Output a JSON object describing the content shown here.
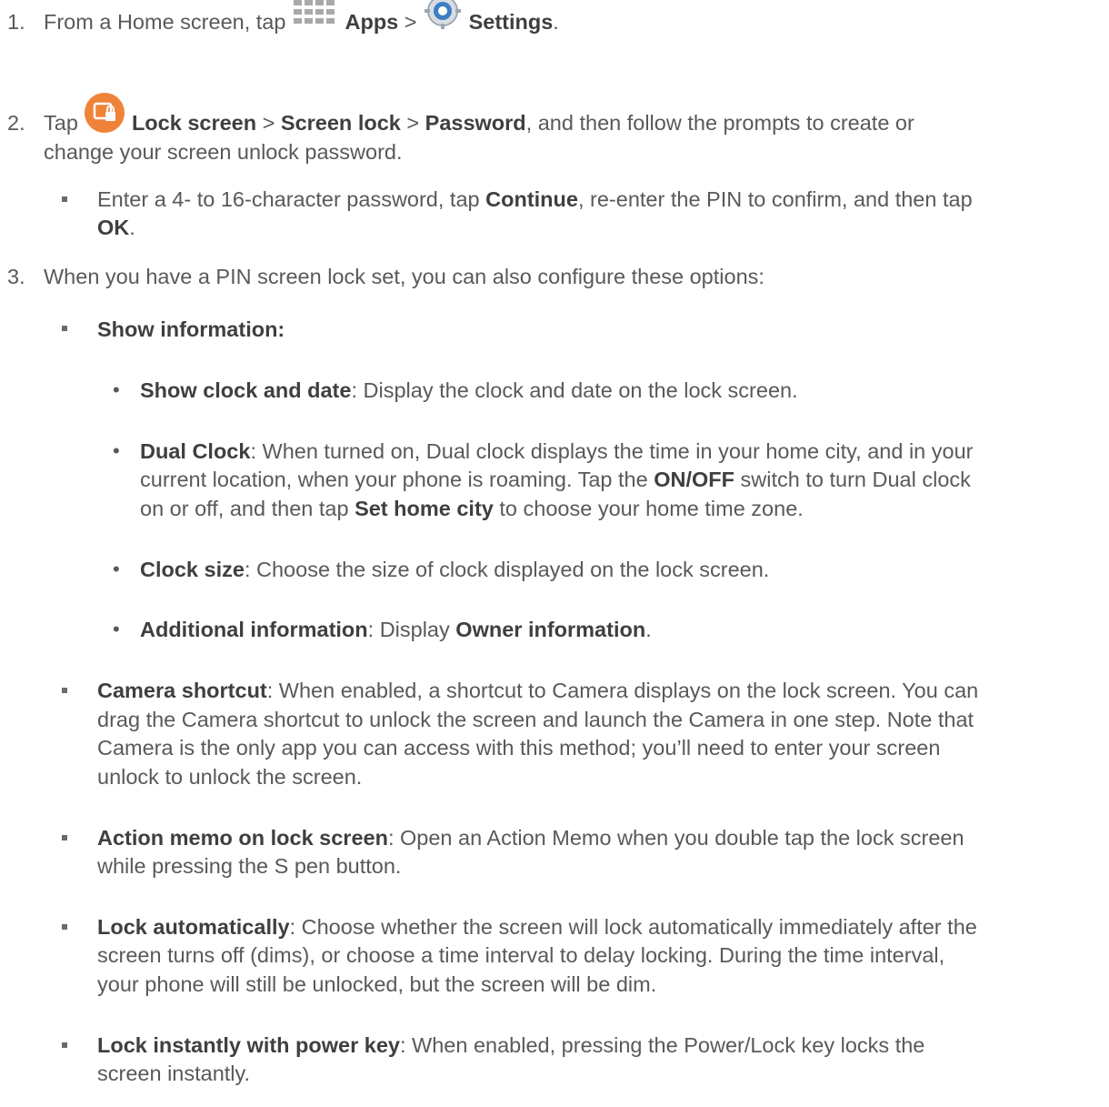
{
  "icons": {
    "apps": "apps-grid-icon",
    "settings": "settings-gear-icon",
    "lock": "lock-screen-icon"
  },
  "colors": {
    "text": "#595959",
    "bold": "#3f3f3f",
    "apps_icon": "#a9a9a9",
    "settings_icon": "#3b7fc4",
    "lock_icon": "#f0833a"
  },
  "steps": {
    "s1": {
      "num": "1.",
      "pre": "From a Home screen, tap",
      "apps": "Apps",
      "gt": ">",
      "settings": "Settings",
      "end": "."
    },
    "s2": {
      "num": "2.",
      "tap": "Tap",
      "lock_screen": "Lock screen",
      "gt1": ">",
      "screen_lock": "Screen lock",
      "gt2": ">",
      "password": "Password",
      "rest1": ", and then follow the prompts to create or",
      "rest2": "change your screen unlock password."
    },
    "s2b": {
      "l1": "Enter a 4- to 16-character password, tap",
      "continue": "Continue",
      "l1b": ", re-enter the PIN to confirm, and then tap",
      "ok": "OK",
      "dot": "."
    },
    "s3": {
      "num": "3.",
      "text": "When you have a PIN screen lock set, you can also configure these options:"
    }
  },
  "show_information": {
    "title": "Show information:",
    "items": [
      {
        "term": "Show clock and date",
        "desc": ": Display the clock and date on the lock screen."
      },
      {
        "term": "Dual Clock",
        "desc1": ": When turned on, Dual clock displays the time in your home city, and in your",
        "desc2": "current location, when your phone is roaming. Tap the",
        "onoff": "ON/OFF",
        "desc2b": "switch to turn Dual clock",
        "desc3": "on or off, and then tap",
        "home_city": "Set home city",
        "desc3b": "to choose your home time zone."
      },
      {
        "term": "Clock size",
        "desc": ": Choose the size of clock displayed on the lock screen."
      },
      {
        "term": "Additional information",
        "desc": ": Display",
        "owner": "Owner information",
        "end": "."
      }
    ]
  },
  "options": [
    {
      "term": "Camera shortcut",
      "lines": [
        ": When enabled, a shortcut to Camera displays on the lock screen. You can",
        "drag the Camera shortcut to unlock the screen and launch the Camera in one step. Note that",
        "Camera is the only app you can access with this method; you’ll need to enter your screen",
        "unlock to unlock the screen."
      ]
    },
    {
      "term": "Action memo on lock screen",
      "lines": [
        ": Open an Action Memo when you double tap the lock screen",
        "while pressing the S pen button."
      ]
    },
    {
      "term": "Lock automatically",
      "lines": [
        ": Choose whether the screen will lock automatically immediately after the",
        "screen turns off (dims), or choose a time interval to delay locking. During the time interval,",
        "your phone will still be unlocked, but the screen will be dim."
      ]
    },
    {
      "term": "Lock instantly with power key",
      "lines": [
        ": When enabled, pressing the Power/Lock key locks the",
        "screen instantly."
      ]
    }
  ]
}
